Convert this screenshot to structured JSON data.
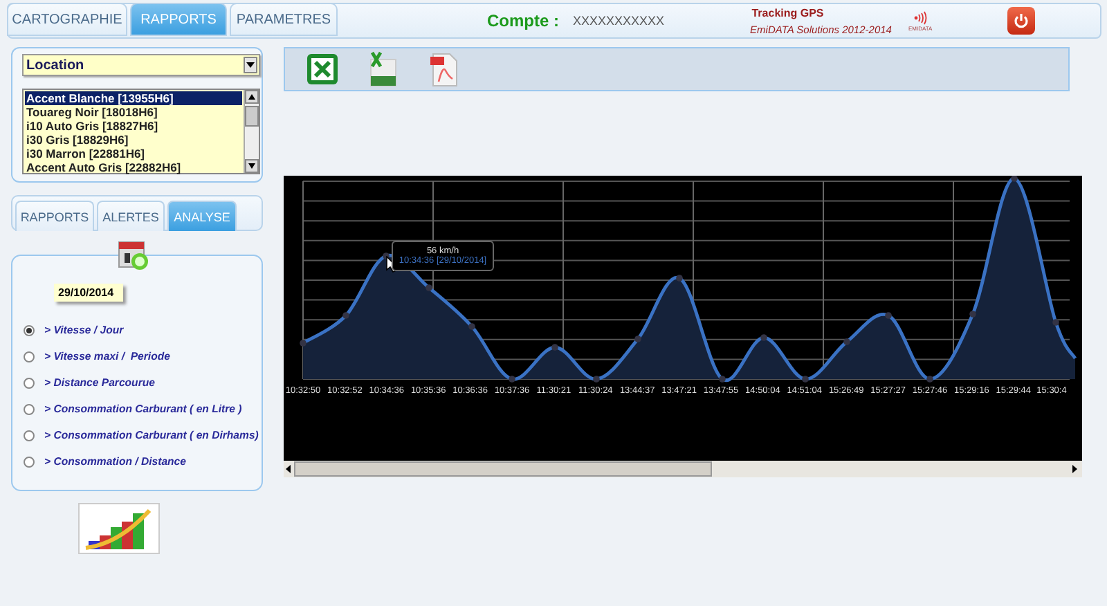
{
  "header": {
    "tabs": [
      {
        "label": "CARTOGRAPHIE",
        "selected": false
      },
      {
        "label": "RAPPORTS",
        "selected": true
      },
      {
        "label": "PARAMETRES",
        "selected": false
      }
    ],
    "account_label": "Compte :",
    "account_value": "XXXXXXXXXXX",
    "app_title": "Tracking GPS",
    "copyright": "EmiDATA Solutions 2012-2014",
    "logo_text": "EMIDATA"
  },
  "vehicle_filter": {
    "value": "Location"
  },
  "vehicles": [
    {
      "name": "Accent Blanche [13955H6]",
      "selected": true
    },
    {
      "name": "Touareg Noir [18018H6]",
      "selected": false
    },
    {
      "name": "i10 Auto Gris [18827H6]",
      "selected": false
    },
    {
      "name": "i30 Gris [18829H6]",
      "selected": false
    },
    {
      "name": "i30 Marron [22881H6]",
      "selected": false
    },
    {
      "name": "Accent Auto Gris [22882H6]",
      "selected": false
    }
  ],
  "report_tabs": [
    {
      "label": "RAPPORTS",
      "selected": false
    },
    {
      "label": "ALERTES",
      "selected": false
    },
    {
      "label": "ANALYSE",
      "selected": true
    }
  ],
  "analysis": {
    "date": "29/10/2014",
    "reports": [
      {
        "label": "> Vitesse / Jour",
        "selected": true
      },
      {
        "label": "> Vitesse maxi /  Periode",
        "selected": false
      },
      {
        "label": "> Distance Parcourue",
        "selected": false
      },
      {
        "label": "> Consommation Carburant ( en Litre )",
        "selected": false
      },
      {
        "label": "> Consommation Carburant ( en Dirhams)",
        "selected": false
      },
      {
        "label": "> Consommation / Distance",
        "selected": false
      }
    ]
  },
  "toolbar": {
    "buttons": [
      {
        "kind": "excel"
      },
      {
        "kind": "csv"
      },
      {
        "kind": "pdf"
      }
    ]
  },
  "chart": {
    "x_labels": [
      "10:32:50",
      "10:32:52",
      "10:34:36",
      "10:35:36",
      "10:36:36",
      "10:37:36",
      "11:30:21",
      "11:30:24",
      "13:44:37",
      "13:47:21",
      "13:47:55",
      "14:50:04",
      "14:51:04",
      "15:26:49",
      "15:27:27",
      "15:27:46",
      "15:29:16",
      "15:29:44",
      "15:30:4"
    ],
    "tooltip": {
      "value": "56 km/h",
      "time": "10:34:36 [29/10/2014]"
    }
  }
}
